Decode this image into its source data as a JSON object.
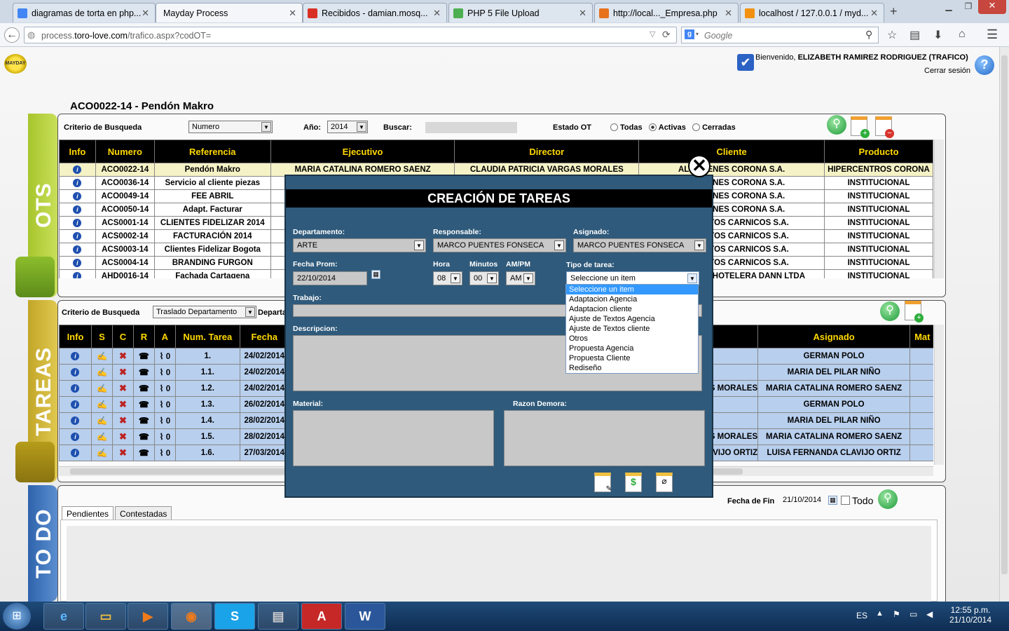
{
  "browser": {
    "tabs": [
      {
        "title": "diagramas de torta en php...",
        "color": "#4285f4"
      },
      {
        "title": "Mayday Process",
        "color": "#cccccc"
      },
      {
        "title": "Recibidos - damian.mosq...",
        "color": "#d93025"
      },
      {
        "title": "PHP 5 File Upload",
        "color": "#4caf50"
      },
      {
        "title": "http://local..._Empresa.php",
        "color": "#e8711c"
      },
      {
        "title": "localhost / 127.0.0.1 / myd...",
        "color": "#f29111"
      }
    ],
    "url_prefix": "process.",
    "url_domain": "toro-love.com",
    "url_path": "/trafico.aspx?codOT=",
    "search_placeholder": "Google"
  },
  "header": {
    "welcome": "Bienvenido,",
    "user": "ELIZABETH RAMIREZ RODRIGUEZ (TRAFICO)",
    "logout": "Cerrar sesión",
    "help": "?",
    "logo_text": "MAYDAY"
  },
  "ot_title": "ACO0022-14 - Pendón Makro",
  "ots": {
    "side_label": "OTS",
    "criterio_label": "Criterio de Busqueda",
    "criterio_value": "Numero",
    "anio_label": "Año:",
    "anio_value": "2014",
    "buscar_label": "Buscar:",
    "estado_label": "Estado OT",
    "estado_options": [
      "Todas",
      "Activas",
      "Cerradas"
    ],
    "columns": [
      "Info",
      "Numero",
      "Referencia",
      "Ejecutivo",
      "Director",
      "Cliente",
      "Producto"
    ],
    "rows": [
      [
        "ACO0022-14",
        "Pendón Makro",
        "MARIA CATALINA ROMERO SAENZ",
        "CLAUDIA PATRICIA VARGAS MORALES",
        "ALMACENES CORONA S.A.",
        "HIPERCENTROS CORONA"
      ],
      [
        "ACO0036-14",
        "Servicio al cliente piezas",
        "",
        "",
        "ALMACENES CORONA S.A.",
        "INSTITUCIONAL"
      ],
      [
        "ACO0049-14",
        "FEE ABRIL",
        "",
        "",
        "ALMACENES CORONA S.A.",
        "INSTITUCIONAL"
      ],
      [
        "ACO0050-14",
        "Adapt. Facturar",
        "",
        "",
        "ALMACENES CORONA S.A.",
        "INSTITUCIONAL"
      ],
      [
        "ACS0001-14",
        "CLIENTES FIDELIZAR 2014",
        "",
        "",
        "PRODUCTOS CARNICOS S.A.",
        "INSTITUCIONAL"
      ],
      [
        "ACS0002-14",
        "FACTURACIÓN 2014",
        "",
        "",
        "PRODUCTOS CARNICOS S.A.",
        "INSTITUCIONAL"
      ],
      [
        "ACS0003-14",
        "Clientes Fidelizar Bogota",
        "",
        "",
        "PRODUCTOS CARNICOS S.A.",
        "INSTITUCIONAL"
      ],
      [
        "ACS0004-14",
        "BRANDING FURGON",
        "",
        "",
        "PRODUCTOS CARNICOS S.A.",
        "INSTITUCIONAL"
      ],
      [
        "AHD0016-14",
        "Fachada Cartagena",
        "",
        "",
        "OPERADORA HOTELERA DANN LTDA",
        "INSTITUCIONAL"
      ]
    ]
  },
  "tareas": {
    "side_label": "TAREAS",
    "criterio_label": "Criterio de Busqueda",
    "criterio_value": "Traslado Departamento",
    "depart_label": "Departamento",
    "columns": [
      "Info",
      "S",
      "C",
      "R",
      "A",
      "Num. Tarea",
      "Fecha",
      "Asignado",
      "Mat"
    ],
    "rows": [
      {
        "a": "0",
        "num": "1.",
        "fecha": "24/02/2014",
        "mid": "",
        "asignado": "GERMAN POLO"
      },
      {
        "a": "0",
        "num": "1.1.",
        "fecha": "24/02/2014",
        "mid": "",
        "asignado": "MARIA DEL PILAR NIÑO"
      },
      {
        "a": "0",
        "num": "1.2.",
        "fecha": "24/02/2014",
        "mid": "CLAUDIA PATRICIA VARGAS MORALES",
        "asignado": "MARIA CATALINA ROMERO SAENZ"
      },
      {
        "a": "0",
        "num": "1.3.",
        "fecha": "26/02/2014",
        "mid": "",
        "asignado": "GERMAN POLO"
      },
      {
        "a": "0",
        "num": "1.4.",
        "fecha": "28/02/2014",
        "mid": "",
        "asignado": "MARIA DEL PILAR NIÑO"
      },
      {
        "a": "0",
        "num": "1.5.",
        "fecha": "28/02/2014",
        "mid": "CLAUDIA PATRICIA VARGAS MORALES",
        "asignado": "MARIA CATALINA ROMERO SAENZ"
      },
      {
        "a": "0",
        "num": "1.6.",
        "fecha": "27/03/2014",
        "mid": "LUISA FERNANDA CLAVIJO ORTIZ",
        "asignado": "LUISA FERNANDA CLAVIJO ORTIZ"
      }
    ]
  },
  "todo": {
    "side_label": "TO DO",
    "tabs": [
      "Pendientes",
      "Contestadas"
    ],
    "fecha_fin_label": "Fecha de Fin",
    "fecha_fin_value": "21/10/2014",
    "todo_label": "Todo"
  },
  "modal": {
    "title": "CREACIÓN DE TAREAS",
    "departamento_label": "Departamento:",
    "departamento_value": "ARTE",
    "responsable_label": "Responsable:",
    "responsable_value": "MARCO PUENTES FONSECA",
    "asignado_label": "Asignado:",
    "asignado_value": "MARCO PUENTES FONSECA",
    "fecha_label": "Fecha Prom:",
    "fecha_value": "22/10/2014",
    "hora_label": "Hora",
    "hora_value": "08",
    "minutos_label": "Minutos",
    "minutos_value": "00",
    "ampm_label": "AM/PM",
    "ampm_value": "AM",
    "tipo_label": "Tipo de tarea:",
    "tipo_value": "Seleccione un item",
    "tipo_options": [
      "Seleccione un item",
      "Adaptacion Agencia",
      "Adaptacion cliente",
      "Ajuste de Textos Agencia",
      "Ajuste de Textos cliente",
      "Otros",
      "Propuesta Agencia",
      "Propuesta Cliente",
      "Rediseño"
    ],
    "trabajo_label": "Trabajo:",
    "descripcion_label": "Descripcion:",
    "material_label": "Material:",
    "razon_label": "Razon Demora:"
  },
  "taskbar": {
    "lang": "ES",
    "time": "12:55 p.m.",
    "date": "21/10/2014"
  }
}
